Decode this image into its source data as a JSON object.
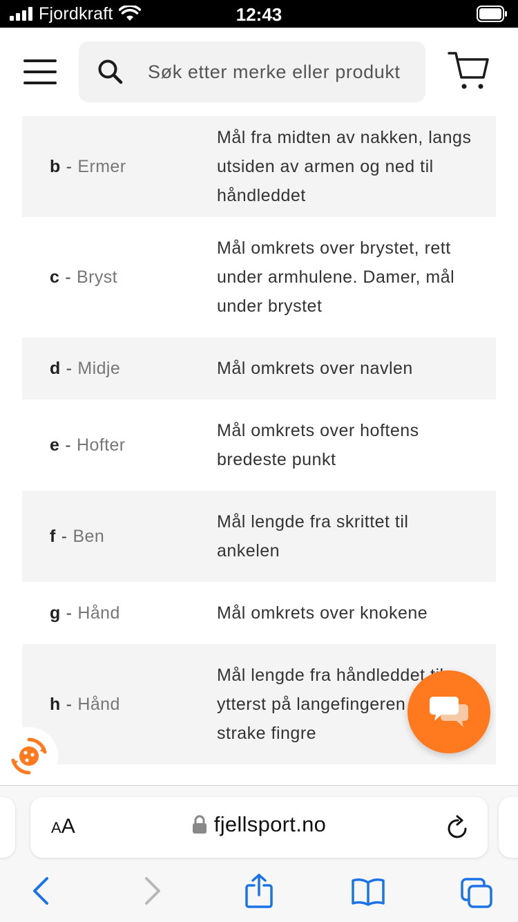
{
  "status_bar": {
    "carrier": "Fjordkraft",
    "time": "12:43",
    "icons": [
      "signal-icon",
      "wifi-icon",
      "battery-icon"
    ]
  },
  "header": {
    "menu_icon": "hamburger-menu-icon",
    "search_placeholder": "Søk etter merke eller produkt",
    "search_icon": "search-icon",
    "cart_icon": "cart-icon"
  },
  "size_guide": {
    "rows": [
      {
        "letter": "b",
        "name": "Ermer",
        "description": "Mål fra midten av nakken, langs utsiden av armen og ned til håndleddet"
      },
      {
        "letter": "c",
        "name": "Bryst",
        "description": "Mål omkrets over brystet, rett under armhulene. Damer, mål under brystet"
      },
      {
        "letter": "d",
        "name": "Midje",
        "description": "Mål omkrets over navlen"
      },
      {
        "letter": "e",
        "name": "Hofter",
        "description": "Mål omkrets over hoftens bredeste punkt"
      },
      {
        "letter": "f",
        "name": "Ben",
        "description": "Mål lengde fra skrittet til ankelen"
      },
      {
        "letter": "g",
        "name": "Hånd",
        "description": "Mål omkrets over knokene"
      },
      {
        "letter": "h",
        "name": "Hånd",
        "description": "Mål lengde fra håndleddet til ytterst på langefingeren med strake fingre"
      }
    ]
  },
  "widgets": {
    "chat_icon": "chat-bubbles-icon",
    "cookie_icon": "cookie-settings-icon",
    "accent_color": "#ff7a1f"
  },
  "browser": {
    "text_size_label_small": "A",
    "text_size_label_large": "A",
    "url": "fjellsport.no",
    "icons": [
      "lock-icon",
      "reload-icon",
      "back-icon",
      "forward-icon",
      "share-icon",
      "bookmarks-icon",
      "tabs-icon"
    ],
    "accent_color": "#1a73e8"
  }
}
